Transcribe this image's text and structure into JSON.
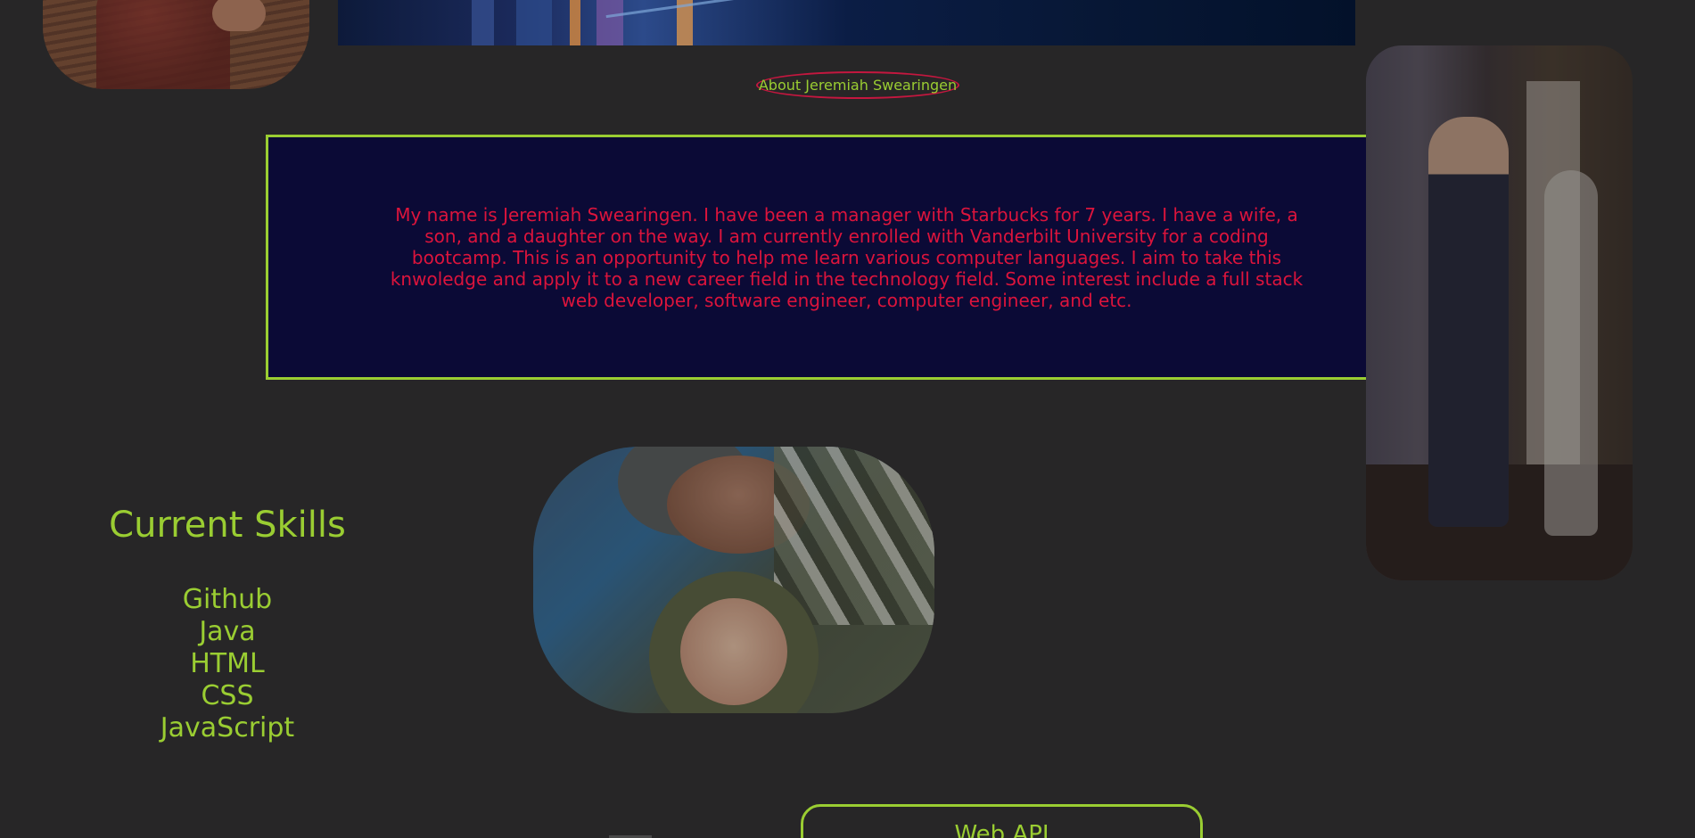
{
  "about": {
    "title": "About Jeremiah Swearingen",
    "text": "My name is Jeremiah Swearingen. I have been a manager with Starbucks for 7 years. I have a wife, a son, and a daughter on the way. I am currently enrolled with Vanderbilt University for a coding bootcamp. This is an opportunity to help me learn various computer languages. I aim to take this knwoledge and apply it to a new career field in the technology field. Some interest include a full stack web developer, software engineer, computer engineer, and etc."
  },
  "skills": {
    "title": "Current Skills",
    "items": [
      "Github",
      "Java",
      "HTML",
      "CSS",
      "JavaScript"
    ]
  },
  "projects": {
    "first_label": "Web API"
  },
  "colors": {
    "background": "#272627",
    "accent": "#9acd32",
    "text_red": "#dc143c",
    "box_bg": "#0b0a36"
  }
}
